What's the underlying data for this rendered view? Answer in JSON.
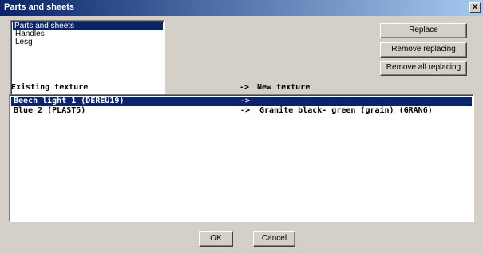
{
  "window": {
    "title": "Parts and sheets",
    "close_label": "x"
  },
  "parts_list": {
    "items": [
      {
        "label": "Parts and sheets",
        "selected": true
      },
      {
        "label": "Handles",
        "selected": false
      },
      {
        "label": "Lesg",
        "selected": false
      }
    ]
  },
  "buttons": {
    "replace": "Replace",
    "remove_replacing": "Remove replacing",
    "remove_all_replacing": "Remove all replacing",
    "ok": "OK",
    "cancel": "Cancel"
  },
  "texture_table": {
    "headers": {
      "existing": "Existing texture",
      "arrow": "->",
      "new": "New texture"
    },
    "rows": [
      {
        "existing": "Beech light 1 (DEREU19)",
        "arrow": "->",
        "new": "",
        "selected": true
      },
      {
        "existing": "Blue 2 (PLAST5)",
        "arrow": "->",
        "new": "Granite black- green (grain) (GRAN6)",
        "selected": false
      }
    ]
  },
  "colors": {
    "selection": "#0a246a",
    "face": "#d4d0c8"
  }
}
